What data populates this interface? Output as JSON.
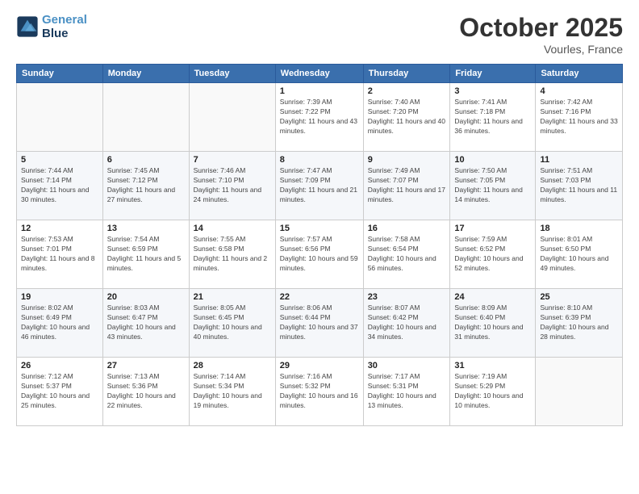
{
  "logo": {
    "line1": "General",
    "line2": "Blue"
  },
  "title": "October 2025",
  "location": "Vourles, France",
  "days_of_week": [
    "Sunday",
    "Monday",
    "Tuesday",
    "Wednesday",
    "Thursday",
    "Friday",
    "Saturday"
  ],
  "weeks": [
    [
      {
        "day": "",
        "sunrise": "",
        "sunset": "",
        "daylight": ""
      },
      {
        "day": "",
        "sunrise": "",
        "sunset": "",
        "daylight": ""
      },
      {
        "day": "",
        "sunrise": "",
        "sunset": "",
        "daylight": ""
      },
      {
        "day": "1",
        "sunrise": "Sunrise: 7:39 AM",
        "sunset": "Sunset: 7:22 PM",
        "daylight": "Daylight: 11 hours and 43 minutes."
      },
      {
        "day": "2",
        "sunrise": "Sunrise: 7:40 AM",
        "sunset": "Sunset: 7:20 PM",
        "daylight": "Daylight: 11 hours and 40 minutes."
      },
      {
        "day": "3",
        "sunrise": "Sunrise: 7:41 AM",
        "sunset": "Sunset: 7:18 PM",
        "daylight": "Daylight: 11 hours and 36 minutes."
      },
      {
        "day": "4",
        "sunrise": "Sunrise: 7:42 AM",
        "sunset": "Sunset: 7:16 PM",
        "daylight": "Daylight: 11 hours and 33 minutes."
      }
    ],
    [
      {
        "day": "5",
        "sunrise": "Sunrise: 7:44 AM",
        "sunset": "Sunset: 7:14 PM",
        "daylight": "Daylight: 11 hours and 30 minutes."
      },
      {
        "day": "6",
        "sunrise": "Sunrise: 7:45 AM",
        "sunset": "Sunset: 7:12 PM",
        "daylight": "Daylight: 11 hours and 27 minutes."
      },
      {
        "day": "7",
        "sunrise": "Sunrise: 7:46 AM",
        "sunset": "Sunset: 7:10 PM",
        "daylight": "Daylight: 11 hours and 24 minutes."
      },
      {
        "day": "8",
        "sunrise": "Sunrise: 7:47 AM",
        "sunset": "Sunset: 7:09 PM",
        "daylight": "Daylight: 11 hours and 21 minutes."
      },
      {
        "day": "9",
        "sunrise": "Sunrise: 7:49 AM",
        "sunset": "Sunset: 7:07 PM",
        "daylight": "Daylight: 11 hours and 17 minutes."
      },
      {
        "day": "10",
        "sunrise": "Sunrise: 7:50 AM",
        "sunset": "Sunset: 7:05 PM",
        "daylight": "Daylight: 11 hours and 14 minutes."
      },
      {
        "day": "11",
        "sunrise": "Sunrise: 7:51 AM",
        "sunset": "Sunset: 7:03 PM",
        "daylight": "Daylight: 11 hours and 11 minutes."
      }
    ],
    [
      {
        "day": "12",
        "sunrise": "Sunrise: 7:53 AM",
        "sunset": "Sunset: 7:01 PM",
        "daylight": "Daylight: 11 hours and 8 minutes."
      },
      {
        "day": "13",
        "sunrise": "Sunrise: 7:54 AM",
        "sunset": "Sunset: 6:59 PM",
        "daylight": "Daylight: 11 hours and 5 minutes."
      },
      {
        "day": "14",
        "sunrise": "Sunrise: 7:55 AM",
        "sunset": "Sunset: 6:58 PM",
        "daylight": "Daylight: 11 hours and 2 minutes."
      },
      {
        "day": "15",
        "sunrise": "Sunrise: 7:57 AM",
        "sunset": "Sunset: 6:56 PM",
        "daylight": "Daylight: 10 hours and 59 minutes."
      },
      {
        "day": "16",
        "sunrise": "Sunrise: 7:58 AM",
        "sunset": "Sunset: 6:54 PM",
        "daylight": "Daylight: 10 hours and 56 minutes."
      },
      {
        "day": "17",
        "sunrise": "Sunrise: 7:59 AM",
        "sunset": "Sunset: 6:52 PM",
        "daylight": "Daylight: 10 hours and 52 minutes."
      },
      {
        "day": "18",
        "sunrise": "Sunrise: 8:01 AM",
        "sunset": "Sunset: 6:50 PM",
        "daylight": "Daylight: 10 hours and 49 minutes."
      }
    ],
    [
      {
        "day": "19",
        "sunrise": "Sunrise: 8:02 AM",
        "sunset": "Sunset: 6:49 PM",
        "daylight": "Daylight: 10 hours and 46 minutes."
      },
      {
        "day": "20",
        "sunrise": "Sunrise: 8:03 AM",
        "sunset": "Sunset: 6:47 PM",
        "daylight": "Daylight: 10 hours and 43 minutes."
      },
      {
        "day": "21",
        "sunrise": "Sunrise: 8:05 AM",
        "sunset": "Sunset: 6:45 PM",
        "daylight": "Daylight: 10 hours and 40 minutes."
      },
      {
        "day": "22",
        "sunrise": "Sunrise: 8:06 AM",
        "sunset": "Sunset: 6:44 PM",
        "daylight": "Daylight: 10 hours and 37 minutes."
      },
      {
        "day": "23",
        "sunrise": "Sunrise: 8:07 AM",
        "sunset": "Sunset: 6:42 PM",
        "daylight": "Daylight: 10 hours and 34 minutes."
      },
      {
        "day": "24",
        "sunrise": "Sunrise: 8:09 AM",
        "sunset": "Sunset: 6:40 PM",
        "daylight": "Daylight: 10 hours and 31 minutes."
      },
      {
        "day": "25",
        "sunrise": "Sunrise: 8:10 AM",
        "sunset": "Sunset: 6:39 PM",
        "daylight": "Daylight: 10 hours and 28 minutes."
      }
    ],
    [
      {
        "day": "26",
        "sunrise": "Sunrise: 7:12 AM",
        "sunset": "Sunset: 5:37 PM",
        "daylight": "Daylight: 10 hours and 25 minutes."
      },
      {
        "day": "27",
        "sunrise": "Sunrise: 7:13 AM",
        "sunset": "Sunset: 5:36 PM",
        "daylight": "Daylight: 10 hours and 22 minutes."
      },
      {
        "day": "28",
        "sunrise": "Sunrise: 7:14 AM",
        "sunset": "Sunset: 5:34 PM",
        "daylight": "Daylight: 10 hours and 19 minutes."
      },
      {
        "day": "29",
        "sunrise": "Sunrise: 7:16 AM",
        "sunset": "Sunset: 5:32 PM",
        "daylight": "Daylight: 10 hours and 16 minutes."
      },
      {
        "day": "30",
        "sunrise": "Sunrise: 7:17 AM",
        "sunset": "Sunset: 5:31 PM",
        "daylight": "Daylight: 10 hours and 13 minutes."
      },
      {
        "day": "31",
        "sunrise": "Sunrise: 7:19 AM",
        "sunset": "Sunset: 5:29 PM",
        "daylight": "Daylight: 10 hours and 10 minutes."
      },
      {
        "day": "",
        "sunrise": "",
        "sunset": "",
        "daylight": ""
      }
    ]
  ]
}
